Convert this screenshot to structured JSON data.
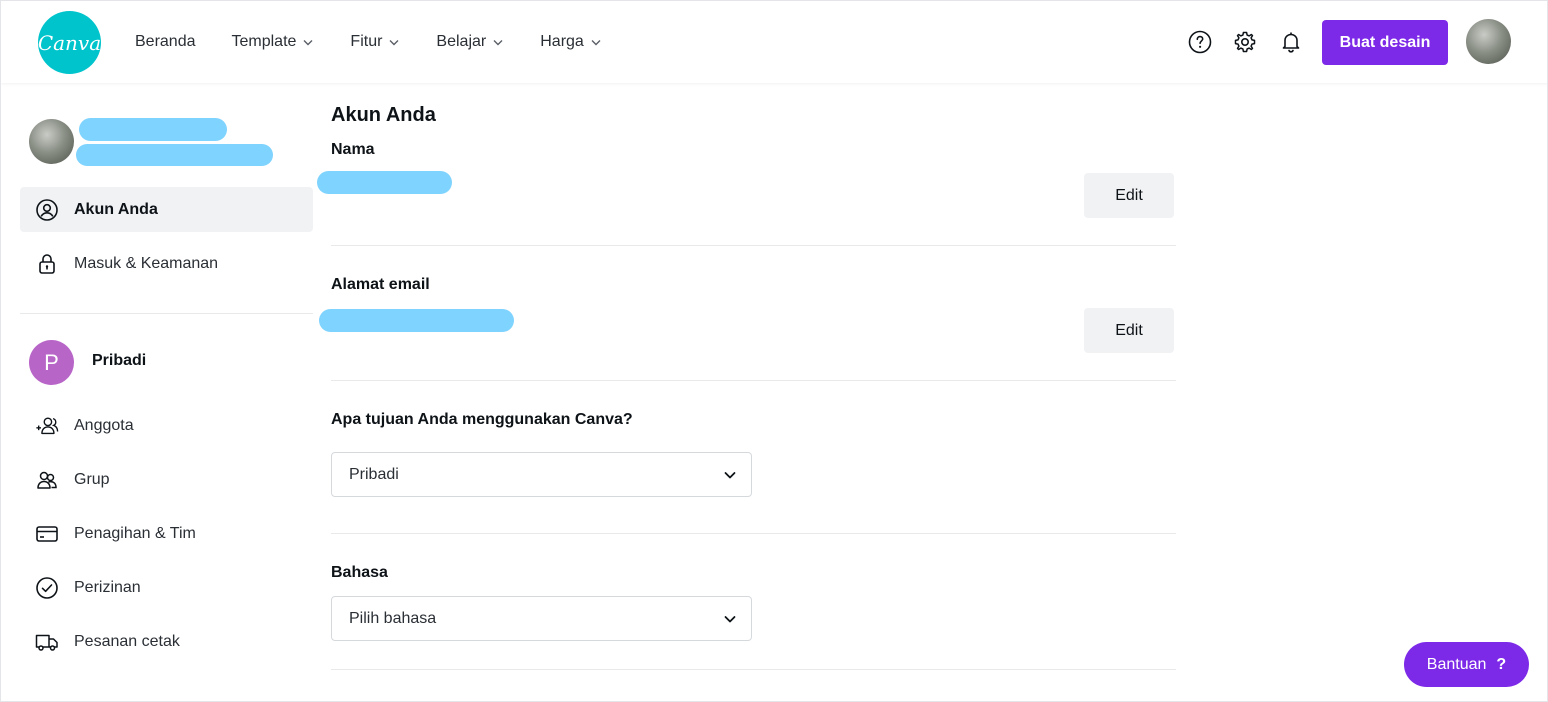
{
  "header": {
    "logo_text": "Canva",
    "nav": [
      {
        "label": "Beranda",
        "dropdown": false
      },
      {
        "label": "Template",
        "dropdown": true
      },
      {
        "label": "Fitur",
        "dropdown": true
      },
      {
        "label": "Belajar",
        "dropdown": true
      },
      {
        "label": "Harga",
        "dropdown": true
      }
    ],
    "create_label": "Buat desain"
  },
  "sidebar": {
    "items_top": [
      {
        "label": "Akun Anda",
        "icon": "user-circle-icon",
        "active": true
      },
      {
        "label": "Masuk & Keamanan",
        "icon": "lock-icon",
        "active": false
      }
    ],
    "team": {
      "initial": "P",
      "name": "Pribadi"
    },
    "items_team": [
      {
        "label": "Anggota",
        "icon": "add-user-icon"
      },
      {
        "label": "Grup",
        "icon": "group-icon"
      },
      {
        "label": "Penagihan & Tim",
        "icon": "credit-card-icon"
      },
      {
        "label": "Perizinan",
        "icon": "check-circle-icon"
      },
      {
        "label": "Pesanan cetak",
        "icon": "truck-icon"
      }
    ]
  },
  "main": {
    "title": "Akun Anda",
    "name_label": "Nama",
    "email_label": "Alamat email",
    "edit_label": "Edit",
    "purpose_label": "Apa tujuan Anda menggunakan Canva?",
    "purpose_value": "Pribadi",
    "language_label": "Bahasa",
    "language_value": "Pilih bahasa"
  },
  "help": {
    "label": "Bantuan",
    "glyph": "?"
  },
  "colors": {
    "brand": "#00c4cc",
    "accent": "#7d2ae8",
    "team_badge": "#b865c8",
    "redaction": "#7fd3ff"
  }
}
